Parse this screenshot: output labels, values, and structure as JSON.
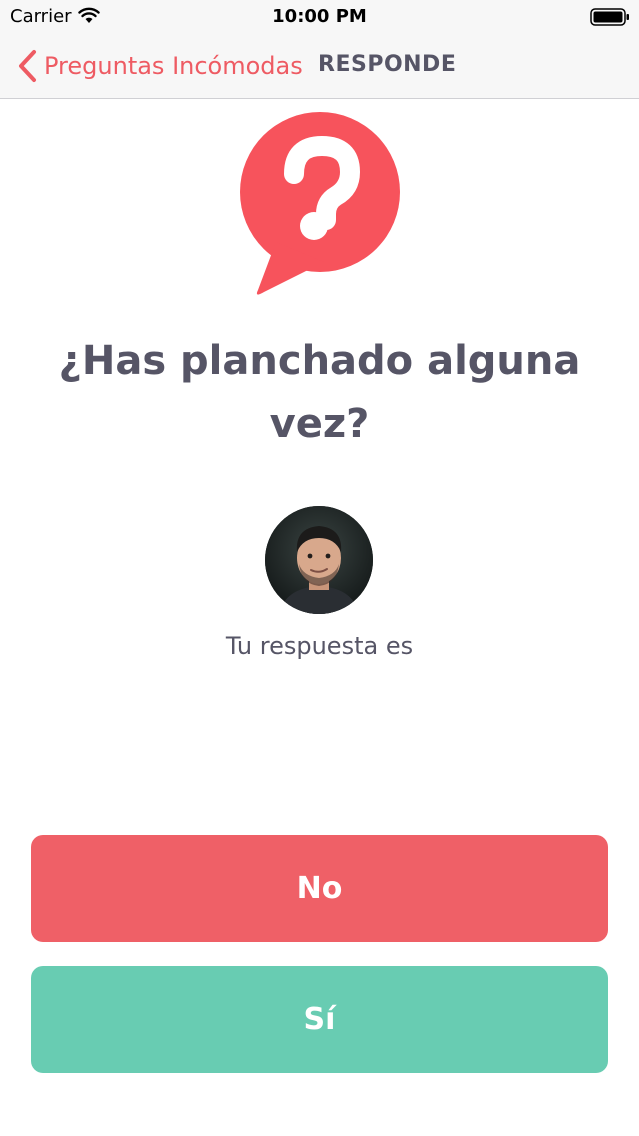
{
  "status_bar": {
    "carrier": "Carrier",
    "time": "10:00 PM",
    "icons": [
      "wifi-icon",
      "battery-icon"
    ]
  },
  "nav": {
    "back_label": "Preguntas Incómodas",
    "title": "RESPONDE",
    "icons": [
      "chevron-left-icon"
    ]
  },
  "question": {
    "logo_icon": "question-bubble-icon",
    "text": "¿Has planchado alguna vez?"
  },
  "profile": {
    "avatar": "avatar",
    "caption": "Tu respuesta es"
  },
  "answers": {
    "no_label": "No",
    "yes_label": "Sí"
  },
  "colors": {
    "accent": "#ee5b63",
    "no_button": "#ef6067",
    "yes_button": "#68ccb2",
    "text_dark": "#565566",
    "bar_background": "#f7f7f7"
  }
}
